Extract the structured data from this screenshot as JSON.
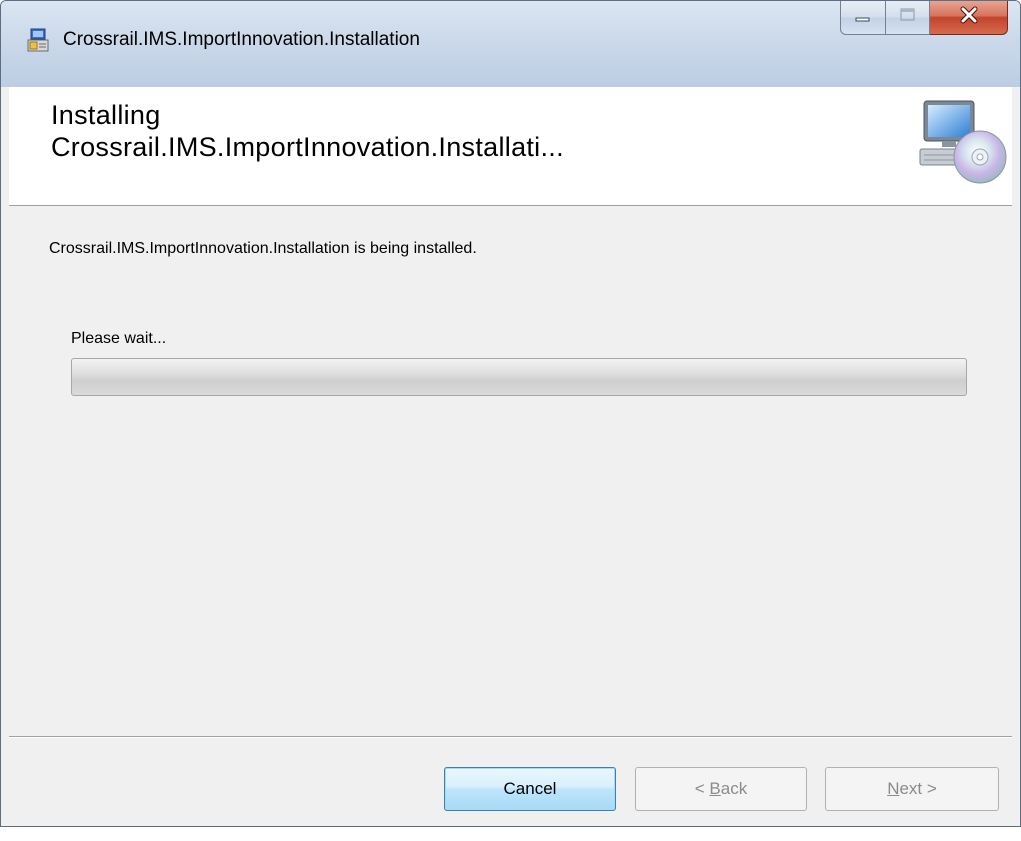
{
  "window": {
    "title": "Crossrail.IMS.ImportInnovation.Installation"
  },
  "banner": {
    "title_line1": "Installing",
    "title_line2": "Crossrail.IMS.ImportInnovation.Installati..."
  },
  "content": {
    "status": "Crossrail.IMS.ImportInnovation.Installation is being installed.",
    "wait_label": "Please wait...",
    "progress_fraction": 0
  },
  "buttons": {
    "cancel": "Cancel",
    "back_prefix": "< ",
    "back_access": "B",
    "back_rest": "ack",
    "next_access": "N",
    "next_rest": "ext >"
  },
  "icons": {
    "title": "installer-icon",
    "banner": "computer-cd-icon",
    "minimize": "minimize-icon",
    "maximize": "maximize-icon",
    "close": "close-icon"
  },
  "colors": {
    "close_button": "#c2442c",
    "primary_button_border": "#3c7fb1",
    "window_background": "#f0f0f0"
  }
}
